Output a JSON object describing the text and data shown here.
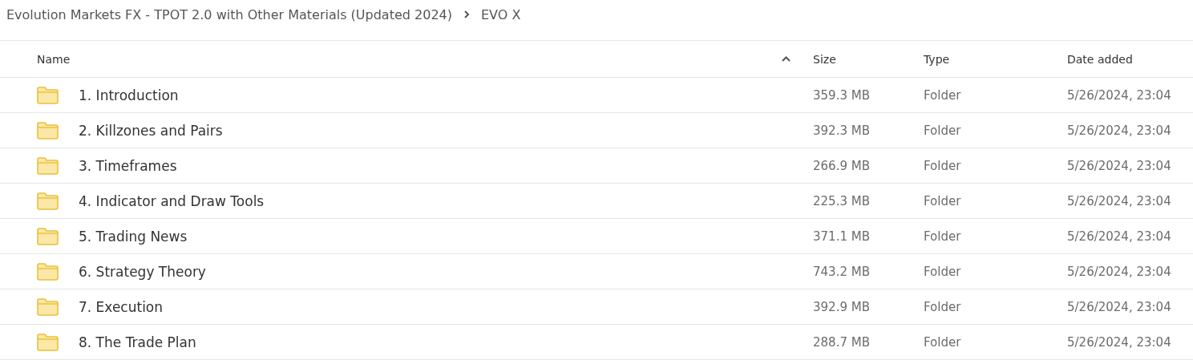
{
  "breadcrumb": [
    "Evolution Markets FX - TPOT 2.0 with Other Materials (Updated 2024)",
    "EVO X"
  ],
  "table": {
    "columns": [
      {
        "label": "Name",
        "sort_ascending": true
      },
      {
        "label": "Size"
      },
      {
        "label": "Type"
      },
      {
        "label": "Date added"
      }
    ],
    "rows": [
      {
        "name": "1. Introduction",
        "size": "359.3 MB",
        "type": "Folder",
        "date": "5/26/2024, 23:04"
      },
      {
        "name": "2. Killzones and Pairs",
        "size": "392.3 MB",
        "type": "Folder",
        "date": "5/26/2024, 23:04"
      },
      {
        "name": "3. Timeframes",
        "size": "266.9 MB",
        "type": "Folder",
        "date": "5/26/2024, 23:04"
      },
      {
        "name": "4. Indicator and Draw Tools",
        "size": "225.3 MB",
        "type": "Folder",
        "date": "5/26/2024, 23:04"
      },
      {
        "name": "5. Trading News",
        "size": "371.1 MB",
        "type": "Folder",
        "date": "5/26/2024, 23:04"
      },
      {
        "name": "6. Strategy Theory",
        "size": "743.2 MB",
        "type": "Folder",
        "date": "5/26/2024, 23:04"
      },
      {
        "name": "7. Execution",
        "size": "392.9 MB",
        "type": "Folder",
        "date": "5/26/2024, 23:04"
      },
      {
        "name": "8. The Trade Plan",
        "size": "288.7 MB",
        "type": "Folder",
        "date": "5/26/2024, 23:04"
      }
    ]
  }
}
